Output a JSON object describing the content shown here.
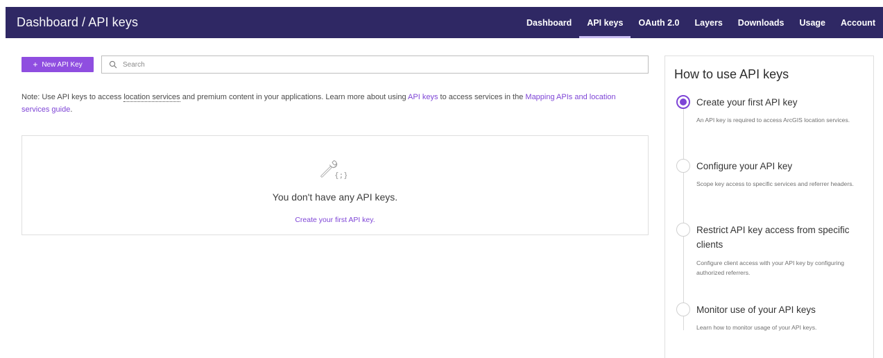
{
  "header": {
    "breadcrumb": "Dashboard / API keys",
    "nav": [
      "Dashboard",
      "API keys",
      "OAuth 2.0",
      "Layers",
      "Downloads",
      "Usage",
      "Account"
    ],
    "active_nav": "API keys"
  },
  "toolbar": {
    "new_key_label": "New API Key",
    "search_placeholder": "Search"
  },
  "note": {
    "part1": "Note: Use API keys to access ",
    "location_services": "location services",
    "part2": " and premium content in your applications. Learn more about using ",
    "api_keys_link": "API keys",
    "part3": " to access services in the ",
    "guide_link": "Mapping APIs and location services guide",
    "part4": "."
  },
  "empty_state": {
    "title": "You don't have any API keys.",
    "link": "Create your first API key."
  },
  "how_to": {
    "title": "How to use API keys",
    "steps": [
      {
        "title": "Create your first API key",
        "desc": "An API key is required to access ArcGIS location services.",
        "active": true
      },
      {
        "title": "Configure your API key",
        "desc": "Scope key access to specific services and referrer headers.",
        "active": false
      },
      {
        "title": "Restrict API key access from specific clients",
        "desc": "Configure client access with your API key by configuring authorized referrers.",
        "active": false
      },
      {
        "title": "Monitor use of your API keys",
        "desc": "Learn how to monitor usage of your API keys.",
        "active": false
      }
    ]
  },
  "colors": {
    "header_bg": "#2f2864",
    "accent": "#7e45d6",
    "button_bg": "#8f4ee0"
  }
}
